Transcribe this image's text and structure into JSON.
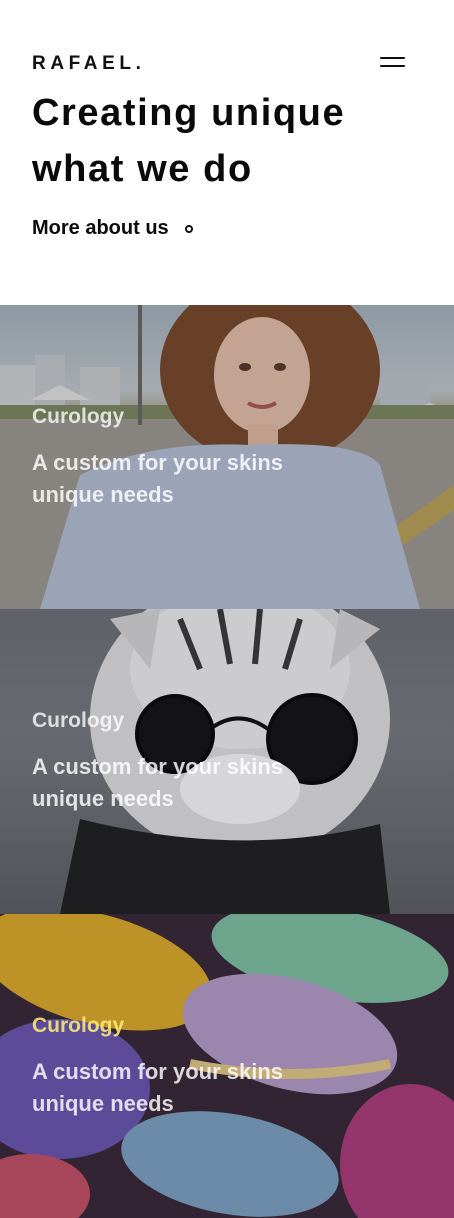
{
  "brand": {
    "logo": "RAFAEL."
  },
  "hero": {
    "headline": "Creating unique what we do",
    "more_link": "More about us"
  },
  "cards": [
    {
      "brand": "Curology",
      "description": "A custom for your skins unique needs",
      "image": "portrait-girl-outdoors"
    },
    {
      "brand": "Curology",
      "description": "A custom for your skins unique needs",
      "image": "cat-with-sunglasses"
    },
    {
      "brand": "Curology",
      "description": "A custom for your skins unique needs",
      "image": "colorful-macarons"
    }
  ],
  "icons": {
    "menu": "hamburger-menu-icon",
    "arrow": "circle-dot-icon"
  },
  "colors": {
    "text": "#0b0b0b",
    "background": "#ffffff",
    "overlay_text": "#ffffff"
  }
}
